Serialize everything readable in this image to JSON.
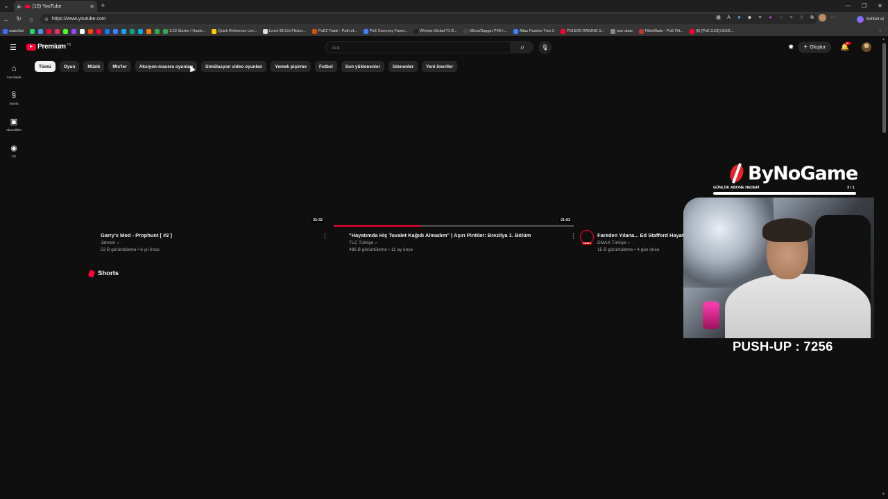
{
  "browser": {
    "tab_title": "(15) YouTube",
    "url": "https://www.youtube.com",
    "chat_button": "Sohbet et",
    "bookmarks": [
      {
        "label": "watchlist",
        "color": "#3d6bff"
      },
      {
        "label": "",
        "color": "#25d366"
      },
      {
        "label": "",
        "color": "#4a90e2"
      },
      {
        "label": "",
        "color": "#ff0033"
      },
      {
        "label": "",
        "color": "#e1306c"
      },
      {
        "label": "",
        "color": "#53fc18"
      },
      {
        "label": "",
        "color": "#9146ff"
      },
      {
        "label": "",
        "color": "#ffffff"
      },
      {
        "label": "",
        "color": "#ff4500"
      },
      {
        "label": "",
        "color": "#ff0033"
      },
      {
        "label": "",
        "color": "#1877f2"
      },
      {
        "label": "",
        "color": "#3b82f6"
      },
      {
        "label": "",
        "color": "#1da1f2"
      },
      {
        "label": "",
        "color": "#10a37f"
      },
      {
        "label": "",
        "color": "#0ea5e9"
      },
      {
        "label": "",
        "color": "#ff7a00"
      },
      {
        "label": "",
        "color": "#34a853"
      },
      {
        "label": "3.23 Starter / Haple...",
        "color": "#34a853"
      },
      {
        "label": "Quick Reference Lev...",
        "color": "#ffcc00"
      },
      {
        "label": "Level 88 Crit Flicker...",
        "color": "#dddddd"
      },
      {
        "label": "PoE2 Trade - Path of...",
        "color": "#d35400"
      },
      {
        "label": "PoE Currency Farmi...",
        "color": "#3b82f6"
      },
      {
        "label": "Whelps Global T1 B...",
        "color": "#222222"
      },
      {
        "label": "XBow/Dagger PVE+...",
        "color": "#444444"
      },
      {
        "label": "Atlas Passive Tree 2",
        "color": "#3b82f6"
      },
      {
        "label": "POISON RAGING S...",
        "color": "#ff0033"
      },
      {
        "label": "poe atlas",
        "color": "#888888"
      },
      {
        "label": "FilterBlade - PoE Filt...",
        "color": "#c0392b"
      },
      {
        "label": "(6) [PoE 3.23] LEAG...",
        "color": "#ff0033"
      }
    ]
  },
  "header": {
    "logo_text": "Premium",
    "logo_country": "TR",
    "search_placeholder": "Ara",
    "create_label": "Oluştur",
    "notif_count": "9+"
  },
  "sidebar": {
    "items": [
      {
        "label": "Ana Sayfa",
        "icon": "⌂"
      },
      {
        "label": "Shorts",
        "icon": "§"
      },
      {
        "label": "Abonelikler",
        "icon": "▣"
      },
      {
        "label": "Siz",
        "icon": "◉"
      }
    ]
  },
  "chips": [
    "Tümü",
    "Oyun",
    "Müzik",
    "Mix'ler",
    "Aksiyon-macera oyunları",
    "Simülasyon video oyunları",
    "Yemek pişirme",
    "Futbol",
    "Son yüklenenler",
    "İzlenenler",
    "Yeni öneriler"
  ],
  "videos": [
    {
      "title": "Garry's Mod - Prophunt [ #2 ]",
      "channel": "Jahrein",
      "meta": "53 B görüntüleme • 6 yıl önce",
      "duration": "32:32"
    },
    {
      "title": "\"Hayatımda Hiç Tuvalet Kağıdı Almadım\" | Aşırı Pintiler: Brezilya 1. Bölüm",
      "channel": "TLC Türkiye",
      "meta": "486 B görüntüleme • 11 ay önce",
      "duration": "21:53",
      "watched_fraction": 0.36
    },
    {
      "title": "Fareden Yılana... Ed Stafford Hayat",
      "channel": "DMAX Türkiye",
      "meta": "15 B görüntüleme • 4 gün önce",
      "live_badge": "CANLI"
    }
  ],
  "shorts_title": "Shorts",
  "overlay": {
    "brand": "ByNoGame",
    "sub_goal_label": "GÜNLÜK ABONE HEDEFİ",
    "sub_goal_count": "3 / 1",
    "sub_goal_fraction": 1.0,
    "pushups": "PUSH-UP : 7256"
  }
}
